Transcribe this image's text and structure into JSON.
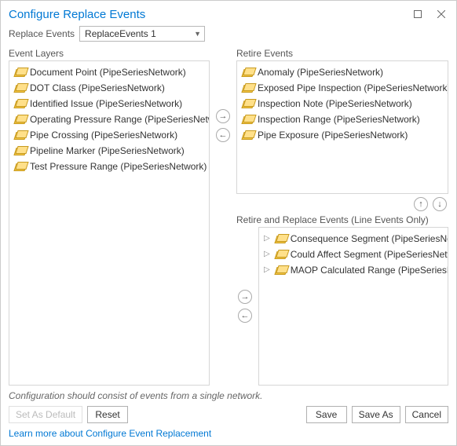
{
  "title": "Configure Replace Events",
  "replaceEvents": {
    "label": "Replace Events",
    "selected": "ReplaceEvents 1"
  },
  "sections": {
    "eventLayers": "Event Layers",
    "retireEvents": "Retire Events",
    "retireReplace": "Retire and Replace Events (Line Events Only)"
  },
  "eventLayers": [
    {
      "label": "Document Point (PipeSeriesNetwork)"
    },
    {
      "label": "DOT Class (PipeSeriesNetwork)"
    },
    {
      "label": "Identified Issue (PipeSeriesNetwork)"
    },
    {
      "label": "Operating Pressure Range (PipeSeriesNetwork)"
    },
    {
      "label": "Pipe Crossing (PipeSeriesNetwork)"
    },
    {
      "label": "Pipeline Marker (PipeSeriesNetwork)"
    },
    {
      "label": "Test Pressure Range (PipeSeriesNetwork)"
    }
  ],
  "retireEvents": [
    {
      "label": "Anomaly (PipeSeriesNetwork)"
    },
    {
      "label": "Exposed Pipe Inspection (PipeSeriesNetwork)"
    },
    {
      "label": "Inspection Note (PipeSeriesNetwork)"
    },
    {
      "label": "Inspection Range (PipeSeriesNetwork)"
    },
    {
      "label": "Pipe Exposure (PipeSeriesNetwork)"
    }
  ],
  "retireReplace": [
    {
      "label": "Consequence Segment (PipeSeriesNetwork)"
    },
    {
      "label": "Could Affect Segment (PipeSeriesNetwork)"
    },
    {
      "label": "MAOP Calculated Range (PipeSeriesNetwork)"
    }
  ],
  "helper": "Configuration should consist of events from a single network.",
  "buttons": {
    "setDefault": "Set As Default",
    "reset": "Reset",
    "save": "Save",
    "saveAs": "Save As",
    "cancel": "Cancel"
  },
  "link": "Learn more about Configure Event Replacement"
}
